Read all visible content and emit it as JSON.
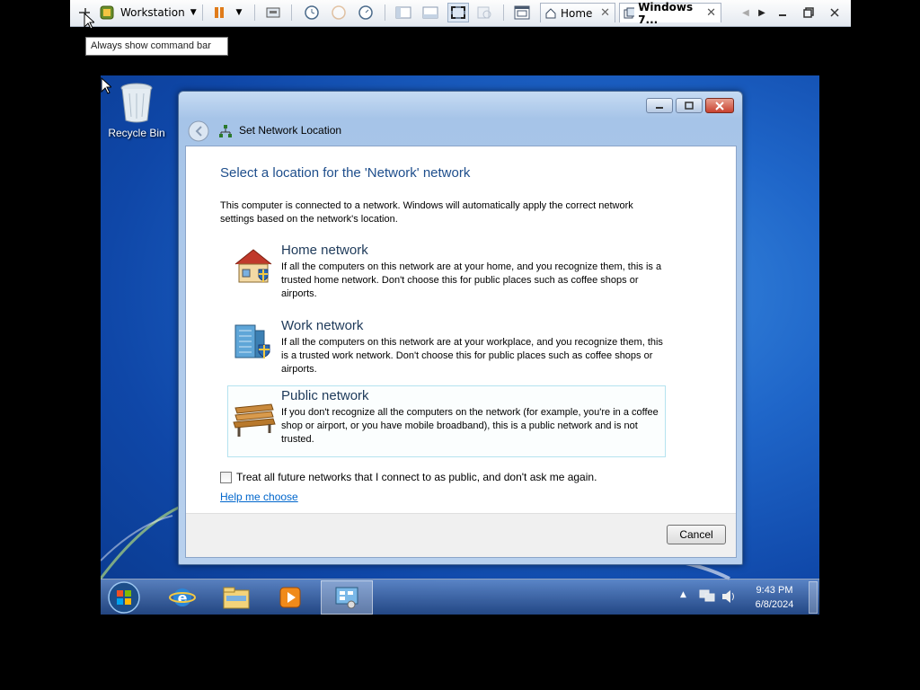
{
  "vmware": {
    "workstation_label": "Workstation",
    "tabs": [
      {
        "label": "Home"
      },
      {
        "label": "Windows 7..."
      }
    ],
    "tooltip": "Always show command bar"
  },
  "desktop": {
    "recycle_bin_label": "Recycle Bin"
  },
  "dialog": {
    "title": "Set Network Location",
    "heading": "Select a location for the 'Network' network",
    "intro": "This computer is connected to a network. Windows will automatically apply the correct network settings based on the network's location.",
    "options": [
      {
        "title": "Home network",
        "description": "If all the computers on this network are at your home, and you recognize them, this is a trusted home network.  Don't choose this for public places such as coffee shops or airports.",
        "icon": "house-shield-icon"
      },
      {
        "title": "Work network",
        "description": "If all the computers on this network are at your workplace, and you recognize them, this is a trusted work network.  Don't choose this for public places such as coffee shops or airports.",
        "icon": "office-building-shield-icon"
      },
      {
        "title": "Public network",
        "description": "If you don't recognize all the computers on the network (for example, you're in a coffee shop or airport, or you have mobile broadband), this is a public network and is not trusted.",
        "icon": "park-bench-icon"
      }
    ],
    "checkbox_label": "Treat all future networks that I connect to as public, and don't ask me again.",
    "checkbox_checked": false,
    "help_link": "Help me choose",
    "cancel_label": "Cancel"
  },
  "taskbar": {
    "time": "9:43 PM",
    "date": "6/8/2024"
  },
  "colors": {
    "heading": "#1e4e8c",
    "link": "#0066cc",
    "close_button": "#c8412f"
  }
}
